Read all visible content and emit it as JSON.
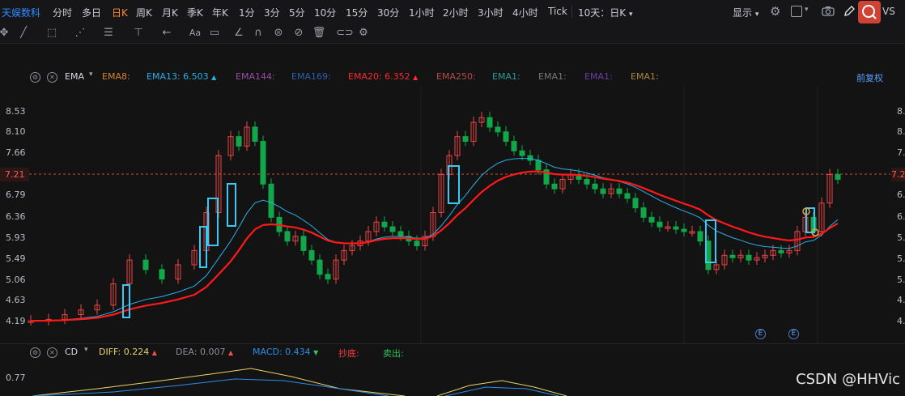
{
  "app": {
    "name": "天娱数科"
  },
  "timeframes": [
    {
      "label": "分时",
      "active": false
    },
    {
      "label": "多日",
      "active": false
    },
    {
      "label": "日K",
      "active": true
    },
    {
      "label": "周K",
      "active": false
    },
    {
      "label": "月K",
      "active": false
    },
    {
      "label": "季K",
      "active": false
    },
    {
      "label": "年K",
      "active": false
    },
    {
      "label": "1分",
      "active": false
    },
    {
      "label": "3分",
      "active": false
    },
    {
      "label": "5分",
      "active": false
    },
    {
      "label": "10分",
      "active": false
    },
    {
      "label": "15分",
      "active": false
    },
    {
      "label": "30分",
      "active": false
    },
    {
      "label": "1小时",
      "active": false
    },
    {
      "label": "2小时",
      "active": false
    },
    {
      "label": "3小时",
      "active": false
    },
    {
      "label": "4小时",
      "active": false
    },
    {
      "label": "Tick",
      "active": false
    }
  ],
  "period_dropdown": "10天：日K",
  "top_right": {
    "display_label": "显示",
    "vs_label": "VS"
  },
  "toolbar_icons": [
    "move-icon",
    "line-icon",
    "rect-icon",
    "wave-icon",
    "fib-icon",
    "vline-icon",
    "arrow-icon",
    "text-icon",
    "note-icon",
    "angle-icon",
    "magnet-icon",
    "sync-icon",
    "hide-icon",
    "trash-icon",
    "link-icon",
    "settings-icon"
  ],
  "main_indicator": {
    "name": "EMA",
    "lines": [
      {
        "label": "EMA8:",
        "value": "",
        "color": "#d9822b"
      },
      {
        "label": "EMA13:",
        "value": "6.503",
        "color": "#2ab0e8"
      },
      {
        "label": "EMA144:",
        "value": "",
        "color": "#9a4fa8"
      },
      {
        "label": "EMA169:",
        "value": "",
        "color": "#2e5fa8"
      },
      {
        "label": "EMA20:",
        "value": "6.352",
        "color": "#ff2a2a"
      },
      {
        "label": "EMA250:",
        "value": "",
        "color": "#b84a4a"
      },
      {
        "label": "EMA1:",
        "value": "",
        "color": "#2a9a9a"
      },
      {
        "label": "EMA1:",
        "value": "",
        "color": "#777777"
      },
      {
        "label": "EMA1:",
        "value": "",
        "color": "#6a3fa8"
      },
      {
        "label": "EMA1:",
        "value": "",
        "color": "#a88a3f"
      }
    ],
    "adjust_label": "前复权"
  },
  "price_axis": [
    "8.53",
    "8.10",
    "7.66",
    "7.21",
    "6.79",
    "6.36",
    "5.93",
    "5.49",
    "5.06",
    "4.63",
    "4.19"
  ],
  "current_price": "7.21",
  "macd": {
    "name": "CD",
    "items": [
      {
        "label": "DIFF:",
        "value": "0.224",
        "color": "#e6d36a",
        "arrow": "up"
      },
      {
        "label": "DEA:",
        "value": "0.007",
        "color": "#2a2a2a",
        "arrow": "up"
      },
      {
        "label": "MACD:",
        "value": "0.434",
        "color": "#2a8ee8",
        "arrow": "down"
      },
      {
        "label": "抄底:",
        "value": "",
        "color": "#ff3b3b",
        "arrow": ""
      },
      {
        "label": "卖出:",
        "value": "",
        "color": "#2ec45a",
        "arrow": ""
      }
    ],
    "axis_label": "0.77"
  },
  "event_badges": [
    "E",
    "E"
  ],
  "watermark": "CSDN @HHVic",
  "colors": {
    "up": "#e84545",
    "down": "#12a84a",
    "ema13": "#2ab0e8",
    "ema20": "#ff1a1a",
    "box": "#3bc8f5",
    "accent": "#ff8a2a"
  }
}
